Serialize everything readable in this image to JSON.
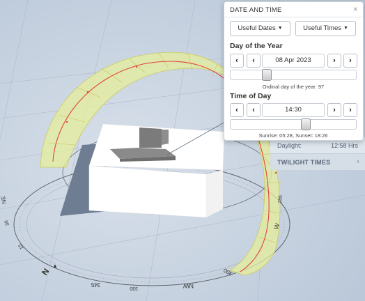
{
  "scene": {
    "compass_labels": {
      "n": "N",
      "nw": "NW",
      "ne": "NE",
      "w": "W",
      "t345": "345",
      "t330": "330",
      "t300": "300",
      "t285": "285",
      "t15": "15",
      "t30": "30"
    }
  },
  "panel": {
    "daylight_label": "Daylight:",
    "daylight_value": "12:58 Hrs",
    "twilight_label": "TWILIGHT TIMES",
    "twilight_chevron": "chevron-right-icon"
  },
  "popup": {
    "title": "DATE AND TIME",
    "close_icon": "close-icon",
    "useful_dates_label": "Useful Dates",
    "useful_times_label": "Useful Times",
    "day_section_title": "Day of the Year",
    "date_value": "08 Apr 2023",
    "day_slider_fraction": 0.265,
    "ordinal_caption": "Ordinal day of the year: 97",
    "time_section_title": "Time of Day",
    "time_value": "14:30",
    "time_slider_fraction": 0.6,
    "sunrise_caption": "Sunrise: 05:28,",
    "sunset_caption": "Sunset: 18:26",
    "nav": {
      "double_prev": "‹",
      "prev": "‹",
      "next": "›",
      "double_next": "›"
    }
  },
  "colors": {
    "sun_band": "#e6ee9b",
    "sun_band_stroke": "#c9cc5a",
    "sun_path_red": "#e0453c",
    "background": "#c9d4e2",
    "compass_ring": "#6a6f78"
  }
}
